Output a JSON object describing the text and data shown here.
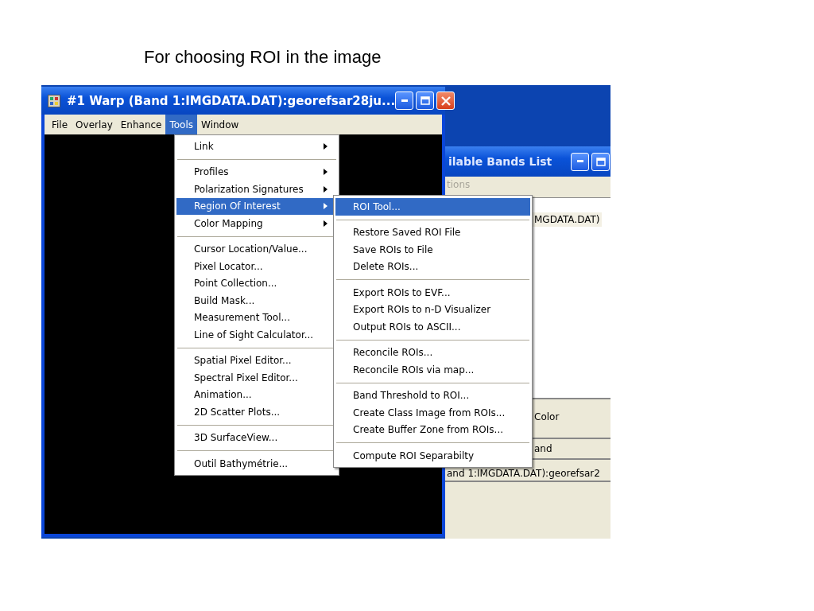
{
  "slide_title": "For choosing ROI in the image",
  "back_window": {
    "title": "ilable Bands List",
    "menu_label": "tions",
    "list_item": "MGDATA.DAT)",
    "color_label": "Color",
    "band_label": "and",
    "band_value": "and 1:IMGDATA.DAT):georefsar2"
  },
  "main_window": {
    "title": "#1 Warp (Band 1:IMGDATA.DAT):georefsar28ju...",
    "menu": [
      {
        "label": "File",
        "selected": false
      },
      {
        "label": "Overlay",
        "selected": false
      },
      {
        "label": "Enhance",
        "selected": false
      },
      {
        "label": "Tools",
        "selected": true
      },
      {
        "label": "Window",
        "selected": false
      }
    ]
  },
  "tools_menu": {
    "groups": [
      [
        {
          "label": "Link",
          "submenu": true,
          "selected": false
        }
      ],
      [
        {
          "label": "Profiles",
          "submenu": true,
          "selected": false
        },
        {
          "label": "Polarization Signatures",
          "submenu": true,
          "selected": false
        },
        {
          "label": "Region Of Interest",
          "submenu": true,
          "selected": true
        },
        {
          "label": "Color Mapping",
          "submenu": true,
          "selected": false
        }
      ],
      [
        {
          "label": "Cursor Location/Value...",
          "submenu": false,
          "selected": false
        },
        {
          "label": "Pixel Locator...",
          "submenu": false,
          "selected": false
        },
        {
          "label": "Point Collection...",
          "submenu": false,
          "selected": false
        },
        {
          "label": "Build Mask...",
          "submenu": false,
          "selected": false
        },
        {
          "label": "Measurement Tool...",
          "submenu": false,
          "selected": false
        },
        {
          "label": "Line of Sight Calculator...",
          "submenu": false,
          "selected": false
        }
      ],
      [
        {
          "label": "Spatial Pixel Editor...",
          "submenu": false,
          "selected": false
        },
        {
          "label": "Spectral Pixel Editor...",
          "submenu": false,
          "selected": false
        },
        {
          "label": "Animation...",
          "submenu": false,
          "selected": false
        },
        {
          "label": "2D Scatter Plots...",
          "submenu": false,
          "selected": false
        }
      ],
      [
        {
          "label": "3D SurfaceView...",
          "submenu": false,
          "selected": false
        }
      ],
      [
        {
          "label": "Outil Bathymétrie...",
          "submenu": false,
          "selected": false
        }
      ]
    ]
  },
  "roi_menu": {
    "groups": [
      [
        {
          "label": "ROI Tool...",
          "submenu": false,
          "selected": true
        }
      ],
      [
        {
          "label": "Restore Saved ROI File",
          "submenu": false,
          "selected": false
        },
        {
          "label": "Save ROIs to File",
          "submenu": false,
          "selected": false
        },
        {
          "label": "Delete ROIs...",
          "submenu": false,
          "selected": false
        }
      ],
      [
        {
          "label": "Export ROIs to EVF...",
          "submenu": false,
          "selected": false
        },
        {
          "label": "Export ROIs to n-D Visualizer",
          "submenu": false,
          "selected": false
        },
        {
          "label": "Output ROIs to ASCII...",
          "submenu": false,
          "selected": false
        }
      ],
      [
        {
          "label": "Reconcile ROIs...",
          "submenu": false,
          "selected": false
        },
        {
          "label": "Reconcile ROIs via map...",
          "submenu": false,
          "selected": false
        }
      ],
      [
        {
          "label": "Band Threshold to ROI...",
          "submenu": false,
          "selected": false
        },
        {
          "label": "Create Class Image from ROIs...",
          "submenu": false,
          "selected": false
        },
        {
          "label": "Create Buffer Zone from ROIs...",
          "submenu": false,
          "selected": false
        }
      ],
      [
        {
          "label": "Compute ROI Separabilty",
          "submenu": false,
          "selected": false
        }
      ]
    ]
  }
}
